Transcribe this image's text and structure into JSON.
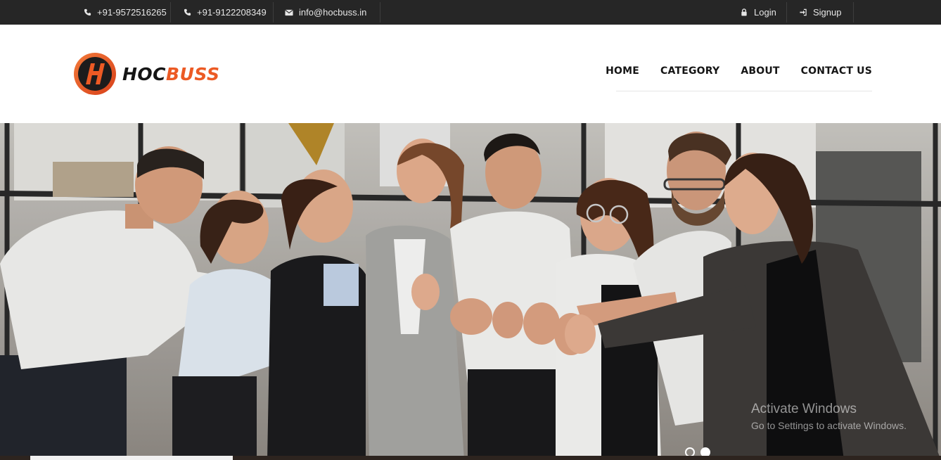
{
  "topbar": {
    "phone1": "+91-9572516265",
    "phone2": "+91-9122208349",
    "email": "info@hocbuss.in",
    "login": "Login",
    "signup": "Signup"
  },
  "logo": {
    "part1": "HOC",
    "part2": "BUSS"
  },
  "nav": {
    "home": "HOME",
    "category": "CATEGORY",
    "about": "ABOUT",
    "contact": "CONTACT US"
  },
  "watermark": {
    "title": "Activate Windows",
    "subtitle": "Go to Settings to activate Windows."
  },
  "colors": {
    "accent": "#ec5a24",
    "topbar": "#262626",
    "text": "#151515"
  },
  "icons": {
    "phone": "phone-icon",
    "mail": "mail-icon",
    "lock": "lock-icon",
    "signin": "sign-in-icon"
  }
}
